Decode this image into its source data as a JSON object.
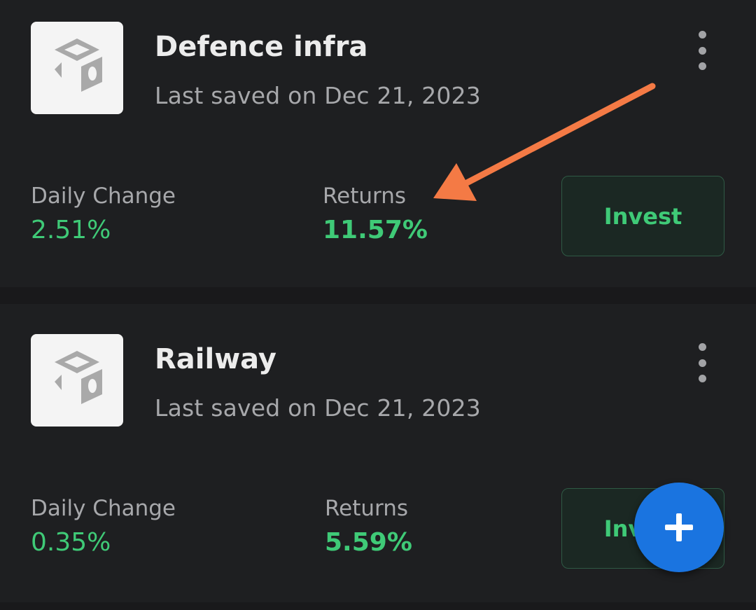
{
  "baskets": [
    {
      "title": "Defence infra",
      "subtitle": "Last saved on Dec 21, 2023",
      "daily_change_label": "Daily Change",
      "daily_change_value": "2.51%",
      "returns_label": "Returns",
      "returns_value": "11.57%",
      "invest_label": "Invest",
      "icon": "basket-cube-icon"
    },
    {
      "title": "Railway",
      "subtitle": "Last saved on Dec 21, 2023",
      "daily_change_label": "Daily Change",
      "daily_change_value": "0.35%",
      "returns_label": "Returns",
      "returns_value": "5.59%",
      "invest_label": "Invest",
      "icon": "basket-cube-icon"
    }
  ],
  "fab": {
    "icon": "plus-icon"
  },
  "colors": {
    "background": "#1e1f21",
    "positive": "#3fca77",
    "fab": "#1a74e0",
    "annotation_arrow": "#f47a45"
  }
}
